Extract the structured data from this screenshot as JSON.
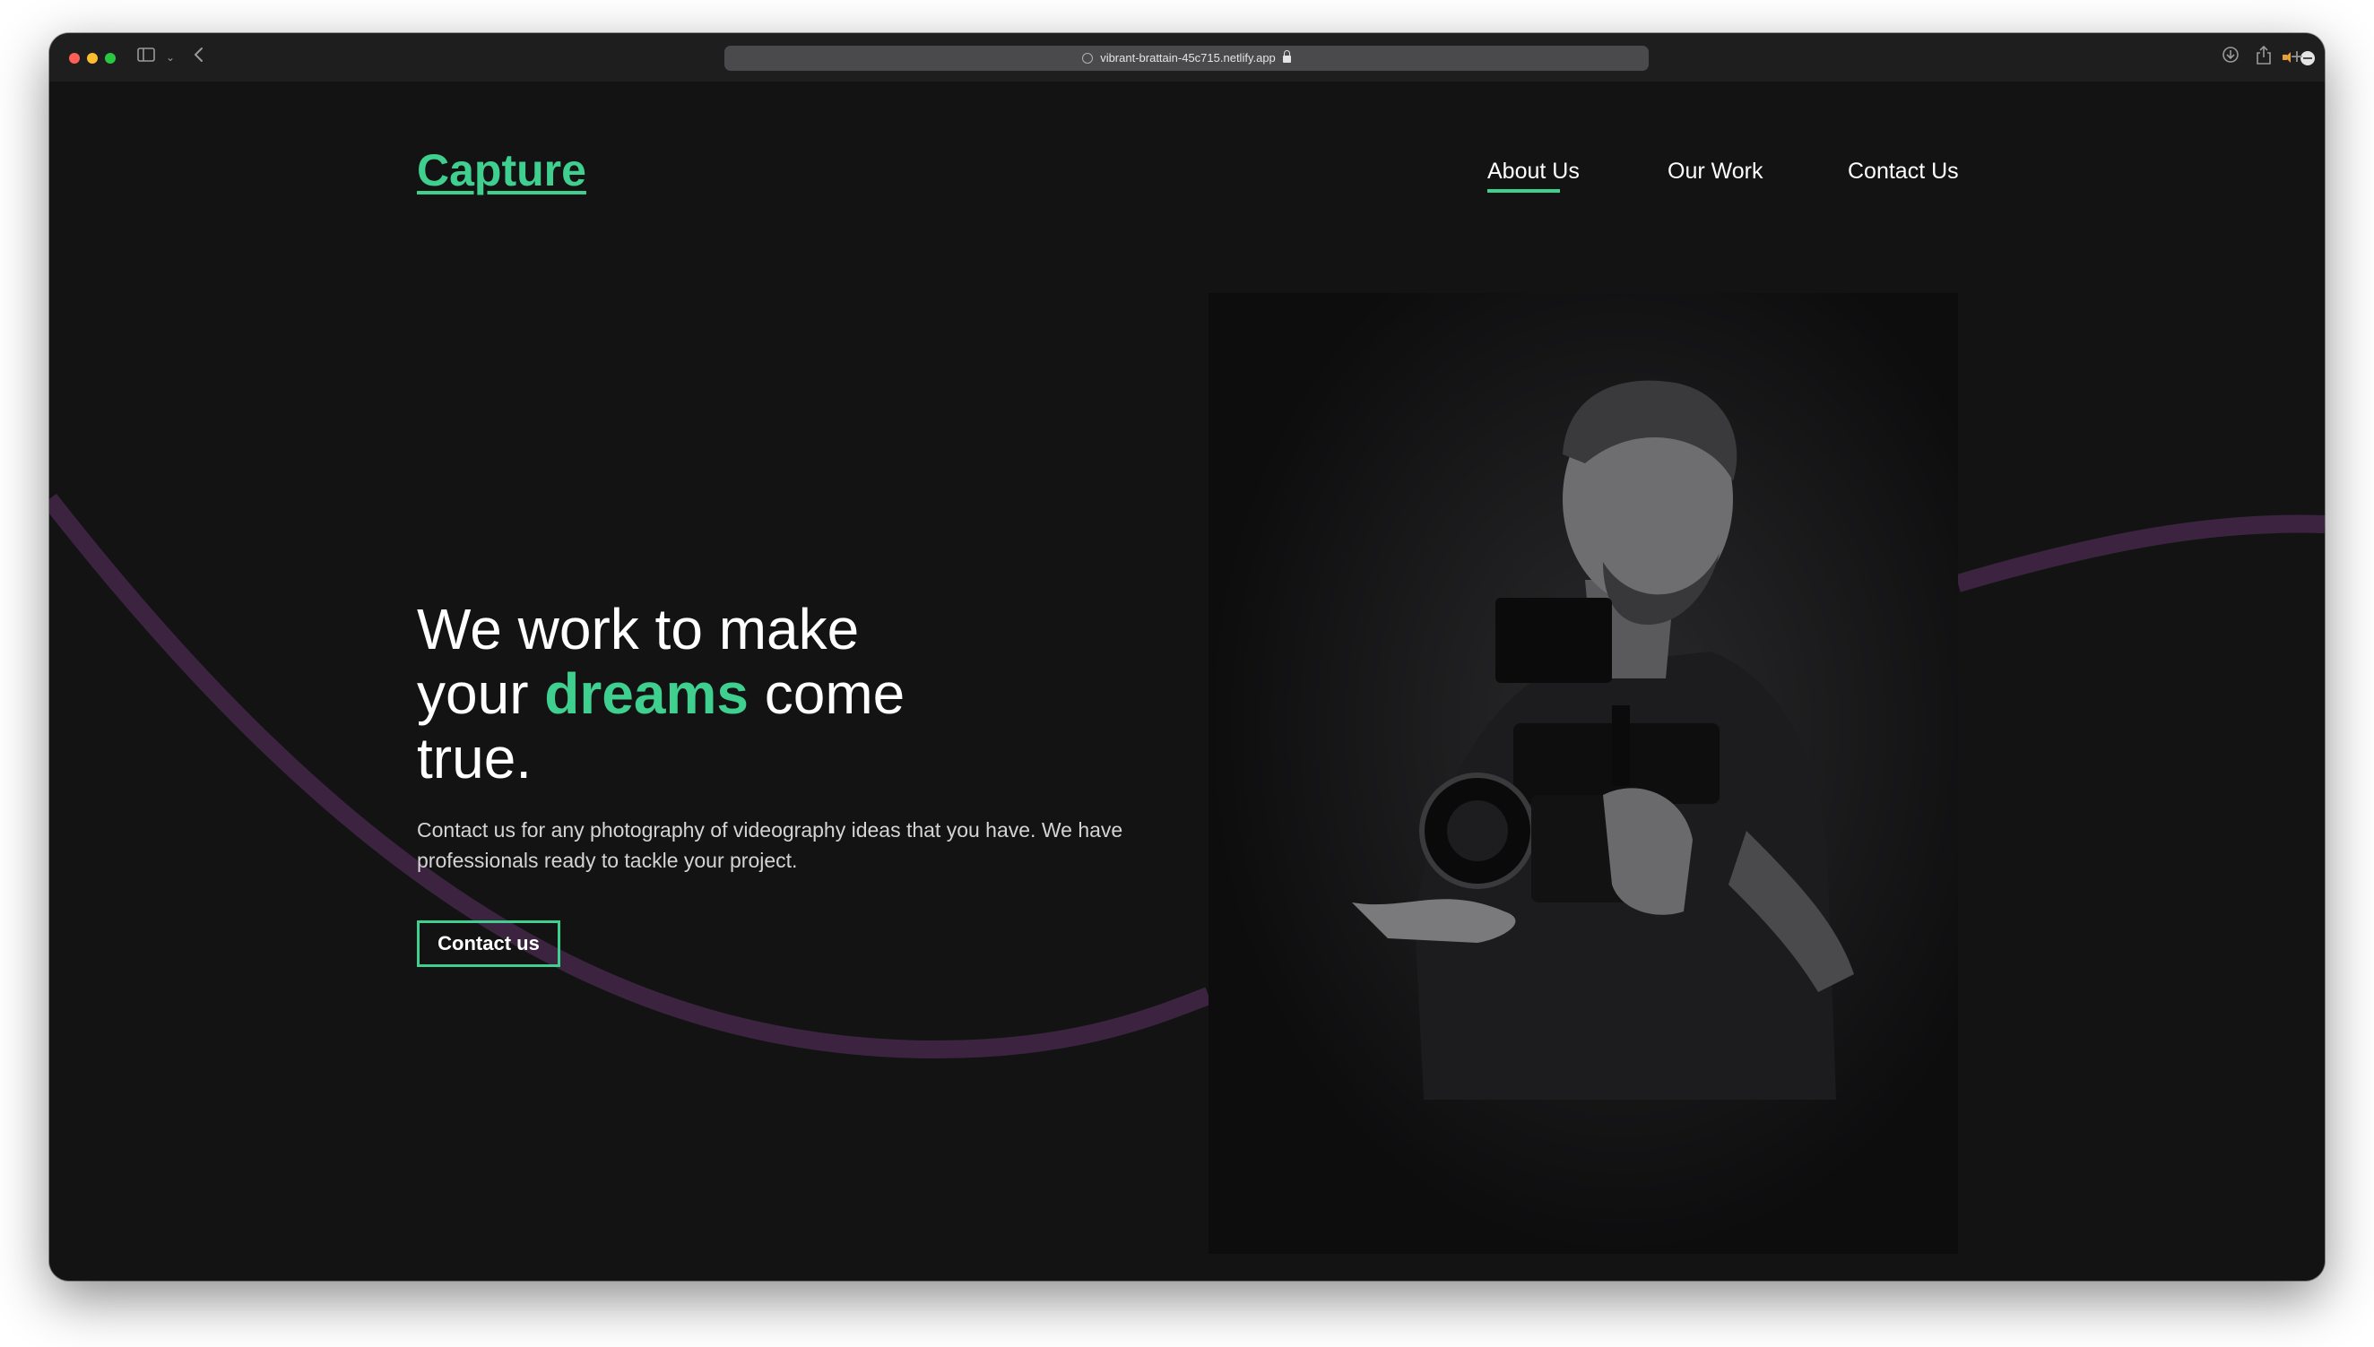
{
  "browser": {
    "url": "vibrant-brattain-45c715.netlify.app"
  },
  "site": {
    "logo": "Capture",
    "nav": [
      {
        "label": "About Us"
      },
      {
        "label": "Our Work"
      },
      {
        "label": "Contact Us"
      }
    ],
    "active_nav": "About Us"
  },
  "hero": {
    "headline_pre": "We work to make your ",
    "headline_accent": "dreams",
    "headline_post": " come true.",
    "description": "Contact us for any photography of videography ideas that you have. We have professionals ready to tackle your project.",
    "cta_label": "Contact us",
    "image_icon": "videographer-photo"
  },
  "colors": {
    "background": "#131314",
    "accent": "#3fcf8e",
    "curve": "#3c2440"
  }
}
